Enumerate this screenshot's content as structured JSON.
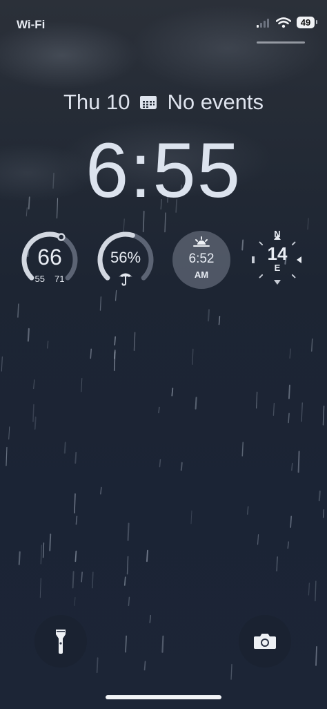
{
  "status_bar": {
    "carrier": "Wi-Fi",
    "battery": "49",
    "icons": [
      "cellular-signal-icon",
      "wifi-icon",
      "battery-icon"
    ]
  },
  "lock_screen": {
    "date": "Thu 10",
    "calendar_icon": "calendar-icon",
    "events": "No events",
    "time": "6:55"
  },
  "widgets": {
    "temperature": {
      "current": "66",
      "low": "55",
      "high": "71",
      "level": 0.6
    },
    "rain": {
      "chance": "56%",
      "icon": "umbrella-icon",
      "level": 0.56
    },
    "sunrise": {
      "time": "6:52",
      "period": "AM",
      "icon": "sunrise-icon"
    },
    "wind": {
      "speed": "14",
      "direction": "E",
      "north": "N",
      "icon": "compass-icon"
    }
  },
  "dock": {
    "left": "flashlight-icon",
    "right": "camera-icon"
  },
  "colors": {
    "text": "#e9edf4",
    "gauge_track": "#5c6474",
    "gauge_fill": "#d3d8e1"
  }
}
